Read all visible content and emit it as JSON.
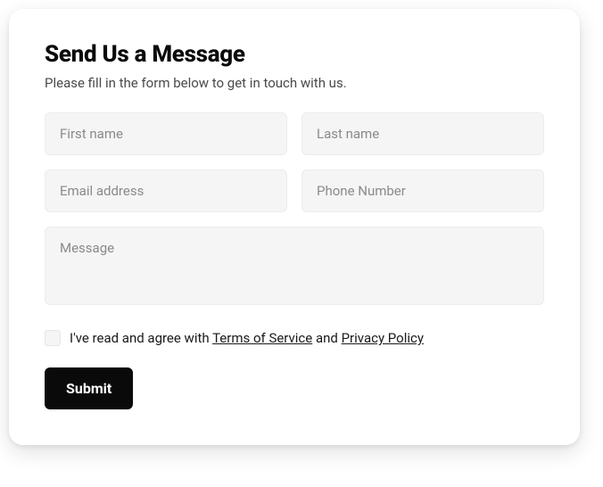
{
  "form": {
    "title": "Send Us a Message",
    "subtitle": "Please fill in the form below to get in touch with us.",
    "fields": {
      "first_name": {
        "placeholder": "First name",
        "value": ""
      },
      "last_name": {
        "placeholder": "Last name",
        "value": ""
      },
      "email": {
        "placeholder": "Email address",
        "value": ""
      },
      "phone": {
        "placeholder": "Phone Number",
        "value": ""
      },
      "message": {
        "placeholder": "Message",
        "value": ""
      }
    },
    "agreement": {
      "checked": false,
      "prefix": "I've read and agree with ",
      "terms_label": "Terms of Service",
      "middle": " and ",
      "privacy_label": "Privacy Policy"
    },
    "submit_label": "Submit"
  }
}
